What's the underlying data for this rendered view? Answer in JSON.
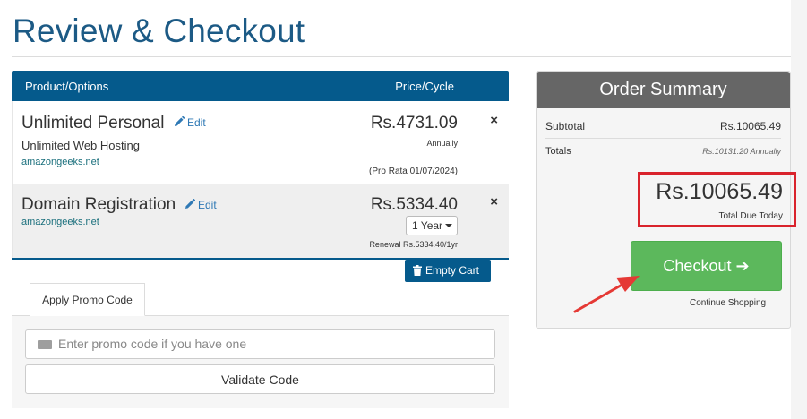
{
  "page": {
    "title": "Review & Checkout"
  },
  "cart": {
    "headers": {
      "product": "Product/Options",
      "price": "Price/Cycle"
    },
    "items": [
      {
        "name": "Unlimited Personal",
        "edit_label": "Edit",
        "description": "Unlimited Web Hosting",
        "domain": "amazongeeks.net",
        "price": "Rs.4731.09",
        "cycle": "Annually",
        "prorata": "(Pro Rata 01/07/2024)",
        "remove_icon": "×"
      },
      {
        "name": "Domain Registration",
        "edit_label": "Edit",
        "domain": "amazongeeks.net",
        "price": "Rs.5334.40",
        "term_selected": "1 Year",
        "renewal": "Renewal Rs.5334.40/1yr",
        "remove_icon": "×"
      }
    ],
    "empty_cart_label": "Empty Cart"
  },
  "promo": {
    "tab_label": "Apply Promo Code",
    "input_placeholder": "Enter promo code if you have one",
    "validate_label": "Validate Code"
  },
  "summary": {
    "title": "Order Summary",
    "subtotal_label": "Subtotal",
    "subtotal_value": "Rs.10065.49",
    "totals_label": "Totals",
    "totals_value": "Rs.10131.20 Annually",
    "total_due": "Rs.10065.49",
    "total_due_label": "Total Due Today",
    "checkout_label": "Checkout",
    "checkout_arrow": "➔",
    "continue_label": "Continue Shopping"
  },
  "colors": {
    "brand_blue": "#055a8c",
    "title_blue": "#1c5a85",
    "checkout_green": "#5cb85c",
    "highlight_red": "#d9232c",
    "summary_header": "#666666"
  }
}
